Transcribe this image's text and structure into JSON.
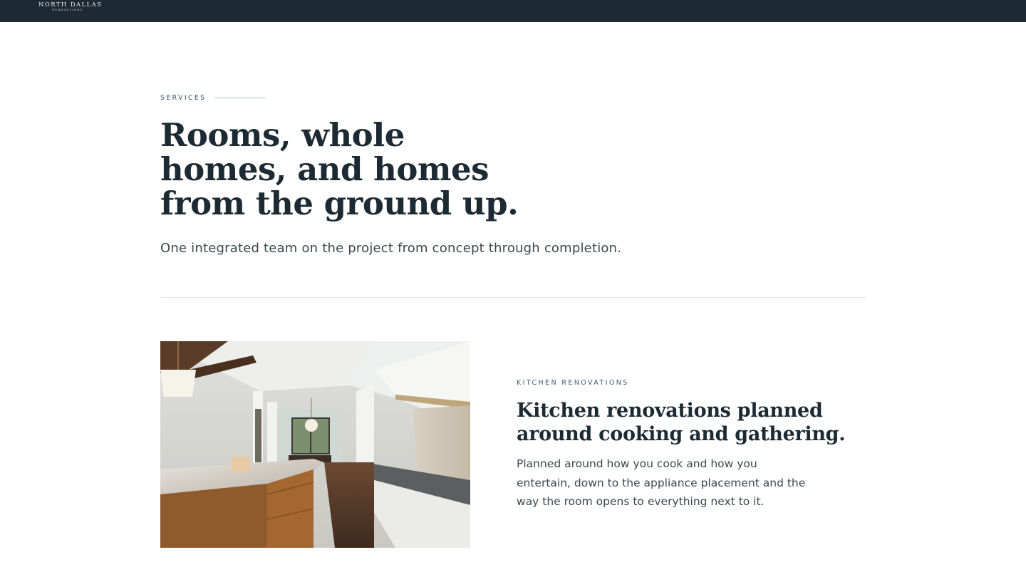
{
  "brand": {
    "name": "NORTH DALLAS",
    "tagline": "RENOVATIONS"
  },
  "colors": {
    "header_bg": "#1d2a33",
    "heading": "#1c2a33",
    "eyebrow": "#3b5a6b",
    "body_text": "#3a4850",
    "divider": "#e1e5e8"
  },
  "services": {
    "eyebrow": "SERVICES",
    "title": "Rooms, whole homes, and homes from the ground up.",
    "subtitle": "One integrated team on the project from concept through completion."
  },
  "kitchen": {
    "image_icon": "kitchen-photo",
    "eyebrow": "KITCHEN RENOVATIONS",
    "title": "Kitchen renovations planned around cooking and gathering.",
    "body": "Planned around how you cook and how you entertain, down to the appliance placement and the way the room opens to everything next to it."
  }
}
